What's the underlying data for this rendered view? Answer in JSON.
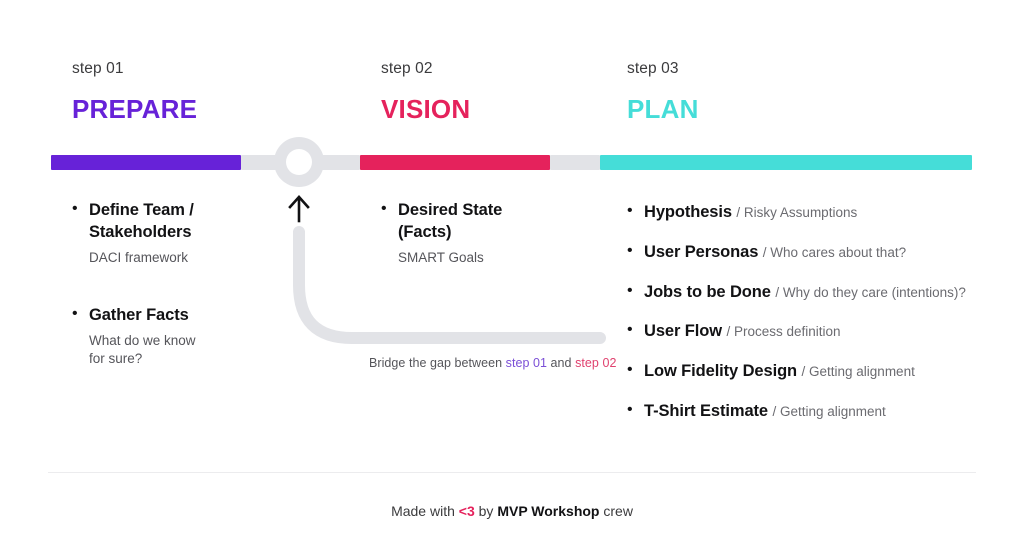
{
  "theme": {
    "purple": "#6722D8",
    "crimson": "#E5225C",
    "teal": "#45DDD8",
    "track_gray": "#E2E3E7",
    "text_dark": "#121214",
    "text_muted": "#55555A"
  },
  "steps": [
    {
      "label": "step 01",
      "title": "PREPARE",
      "color": "#6722D8"
    },
    {
      "label": "step 02",
      "title": "VISION",
      "color": "#E5225C"
    },
    {
      "label": "step 03",
      "title": "PLAN",
      "color": "#45DDD8"
    }
  ],
  "columns": [
    {
      "name": "prepare",
      "items": [
        {
          "title": "Define Team /",
          "title2": "Stakeholders",
          "sub": "DACI framework"
        },
        {
          "title": "Gather Facts",
          "sub": "What do we know",
          "sub2": "for sure?"
        }
      ]
    },
    {
      "name": "vision",
      "items": [
        {
          "title": "Desired State",
          "title2": "(Facts)",
          "sub": "SMART Goals"
        }
      ]
    },
    {
      "name": "plan",
      "items": [
        {
          "title": "Hypothesis",
          "note": "/ Risky Assumptions"
        },
        {
          "title": "User Personas",
          "note": "/ Who cares about that?"
        },
        {
          "title": "Jobs to be Done",
          "note": "/ Why do they care (intentions)?"
        },
        {
          "title": "User Flow",
          "note": "/ Process definition"
        },
        {
          "title": "Low Fidelity Design",
          "note": "/ Getting alignment"
        },
        {
          "title": "T-Shirt Estimate",
          "note": "/ Getting alignment"
        }
      ]
    }
  ],
  "bridge": {
    "caption_before": "Bridge the gap between ",
    "caption_step1": "step 01",
    "caption_middle": " and ",
    "caption_step2": "step 02"
  },
  "footer": {
    "before": "Made with ",
    "heart": "<3",
    "middle": " by ",
    "brand": "MVP Workshop",
    "after": " crew"
  }
}
